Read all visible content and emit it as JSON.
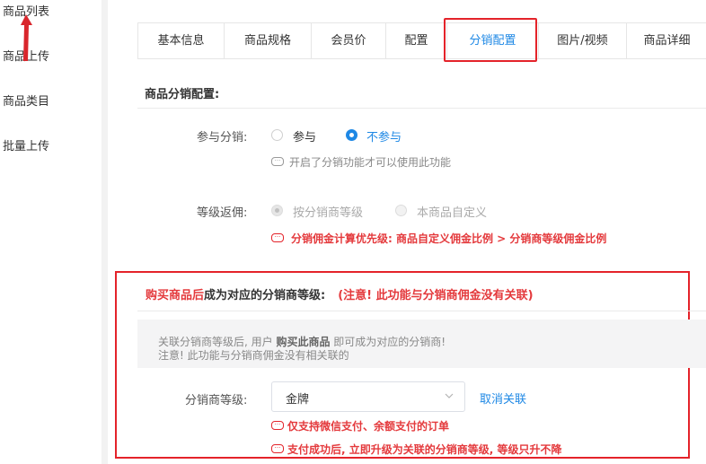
{
  "sidebar": {
    "items": [
      {
        "label": "商品列表"
      },
      {
        "label": "商品上传"
      },
      {
        "label": "商品类目"
      },
      {
        "label": "批量上传"
      }
    ]
  },
  "tabs": [
    {
      "label": "基本信息",
      "active": false
    },
    {
      "label": "商品规格",
      "active": false
    },
    {
      "label": "会员价",
      "active": false
    },
    {
      "label": "配置",
      "active": false
    },
    {
      "label": "分销配置",
      "active": true
    },
    {
      "label": "图片/视频",
      "active": false
    },
    {
      "label": "商品详细",
      "active": false
    }
  ],
  "section_title": "商品分销配置:",
  "participate": {
    "label": "参与分销:",
    "options": [
      "参与",
      "不参与"
    ],
    "selected": "不参与",
    "tip": "开启了分销功能才可以使用此功能"
  },
  "commission": {
    "label": "等级返佣:",
    "options": [
      "按分销商等级",
      "本商品自定义"
    ],
    "selected": "按分销商等级",
    "tip": "分销佣金计算优先级: 商品自定义佣金比例 > 分销商等级佣金比例"
  },
  "purchase": {
    "title_red": "购买商品后",
    "title_dark": "成为对应的分销商等级:",
    "title_note": "(注意! 此功能与分销商佣金没有关联)",
    "info_line1_a": "关联分销商等级后, 用户 ",
    "info_line1_bold": "购买此商品",
    "info_line1_b": " 即可成为对应的分销商!",
    "info_line2": "注意! 此功能与分销商佣金没有相关联的",
    "level_label": "分销商等级:",
    "level_value": "金牌",
    "cancel_link": "取消关联",
    "tip1": "仅支持微信支付、余额支付的订单",
    "tip2": "支付成功后, 立即升级为关联的分销商等级, 等级只升不降"
  },
  "colors": {
    "accent": "#1e88e5",
    "highlight": "#e4232a",
    "warning_text": "#e4393c"
  }
}
